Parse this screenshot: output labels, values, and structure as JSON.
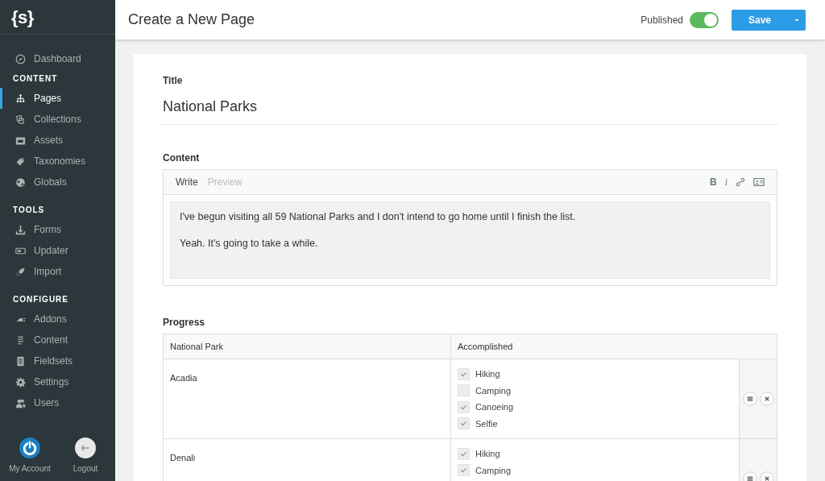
{
  "sidebar": {
    "logo": "{s}",
    "sections": [
      {
        "items": [
          {
            "label": "Dashboard",
            "selected": false
          }
        ]
      },
      {
        "heading": "CONTENT",
        "items": [
          {
            "label": "Pages",
            "selected": true
          },
          {
            "label": "Collections",
            "selected": false
          },
          {
            "label": "Assets",
            "selected": false
          },
          {
            "label": "Taxonomies",
            "selected": false
          },
          {
            "label": "Globals",
            "selected": false
          }
        ]
      },
      {
        "heading": "TOOLS",
        "items": [
          {
            "label": "Forms",
            "selected": false
          },
          {
            "label": "Updater",
            "selected": false
          },
          {
            "label": "Import",
            "selected": false
          }
        ]
      },
      {
        "heading": "CONFIGURE",
        "items": [
          {
            "label": "Addons",
            "selected": false
          },
          {
            "label": "Content",
            "selected": false
          },
          {
            "label": "Fieldsets",
            "selected": false
          },
          {
            "label": "Settings",
            "selected": false
          },
          {
            "label": "Users",
            "selected": false
          }
        ]
      }
    ],
    "footer": [
      {
        "label": "My Account",
        "kind": "account"
      },
      {
        "label": "Logout",
        "kind": "logout"
      }
    ]
  },
  "header": {
    "title": "Create a New Page",
    "published": {
      "label": "Published",
      "on": true
    },
    "save_button": "Save"
  },
  "form": {
    "title_label": "Title",
    "title_value": "National Parks",
    "content_label": "Content",
    "editor": {
      "tabs": [
        {
          "label": "Write",
          "selected": true
        },
        {
          "label": "Preview",
          "selected": false
        }
      ],
      "toolbar": [
        {
          "kind": "bold",
          "label": "B"
        },
        {
          "kind": "italic",
          "label": "i"
        },
        {
          "kind": "link"
        },
        {
          "kind": "image"
        }
      ],
      "paragraphs": [
        "I've begun visiting all 59 National Parks and I don't intend to go home until I finish the list.",
        "Yeah. It's going to take a while."
      ]
    },
    "progress_label": "Progress",
    "table": {
      "columns": [
        "National Park",
        "Accomplished"
      ],
      "rows": [
        {
          "park": "Acadia",
          "options": [
            {
              "label": "Hiking",
              "checked": true
            },
            {
              "label": "Camping",
              "checked": false
            },
            {
              "label": "Canoeing",
              "checked": true
            },
            {
              "label": "Selfie",
              "checked": true
            }
          ]
        },
        {
          "park": "Denali",
          "options": [
            {
              "label": "Hiking",
              "checked": true
            },
            {
              "label": "Camping",
              "checked": true
            }
          ]
        }
      ]
    }
  }
}
